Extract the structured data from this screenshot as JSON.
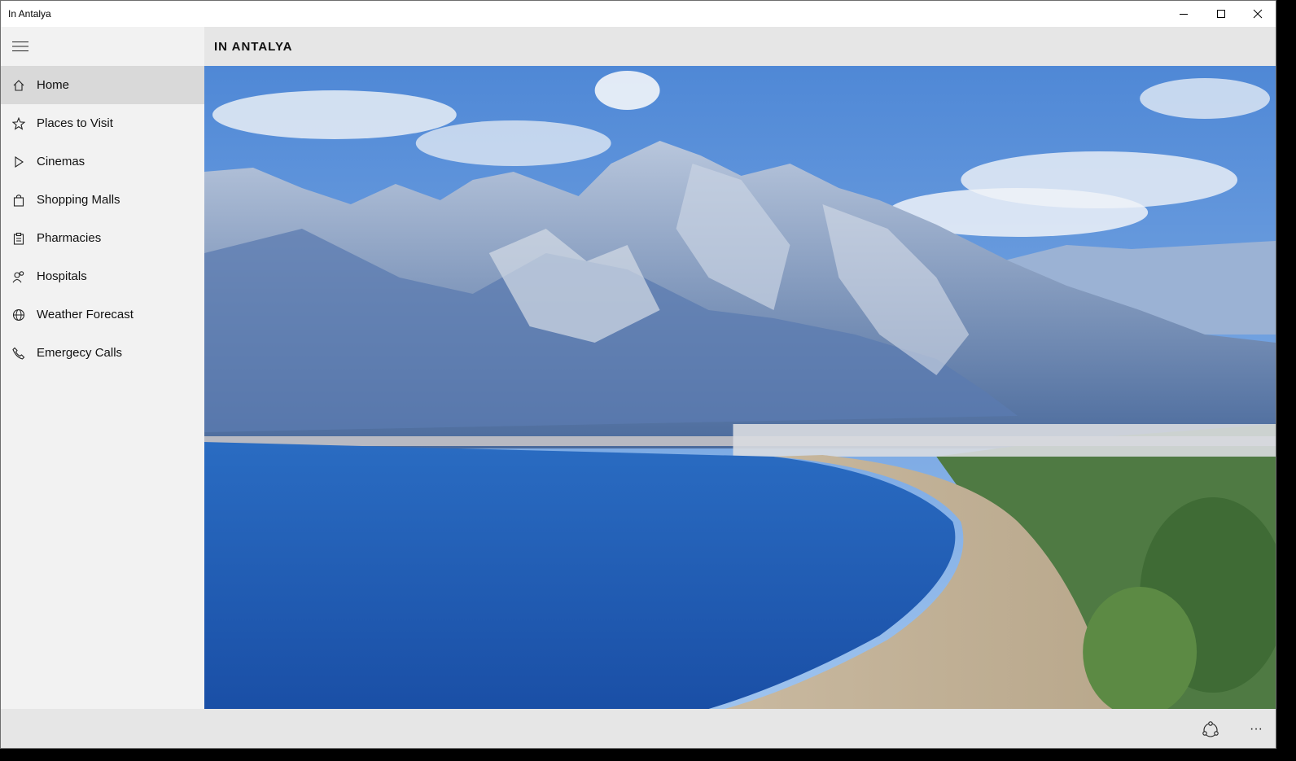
{
  "window": {
    "title": "In Antalya"
  },
  "header": {
    "title": "IN ANTALYA"
  },
  "nav": {
    "items": [
      {
        "label": "Home",
        "icon": "home-icon",
        "active": true
      },
      {
        "label": "Places to Visit",
        "icon": "star-icon"
      },
      {
        "label": "Cinemas",
        "icon": "play-icon"
      },
      {
        "label": "Shopping Malls",
        "icon": "shopping-bag-icon"
      },
      {
        "label": "Pharmacies",
        "icon": "clipboard-icon"
      },
      {
        "label": "Hospitals",
        "icon": "people-icon"
      },
      {
        "label": "Weather Forecast",
        "icon": "globe-icon"
      },
      {
        "label": "Emergecy Calls",
        "icon": "phone-icon"
      }
    ]
  },
  "hero": {
    "alt": "Antalya coastline with mountains, blue sea and beach"
  },
  "appbar": {
    "share_icon": "share-icon",
    "more_icon": "more-icon",
    "more_label": "···"
  },
  "colors": {
    "sidebar_bg": "#f2f2f2",
    "active_item": "#d9d9d9",
    "header_bg": "#e6e6e6",
    "sea": "#1f5fb8"
  }
}
